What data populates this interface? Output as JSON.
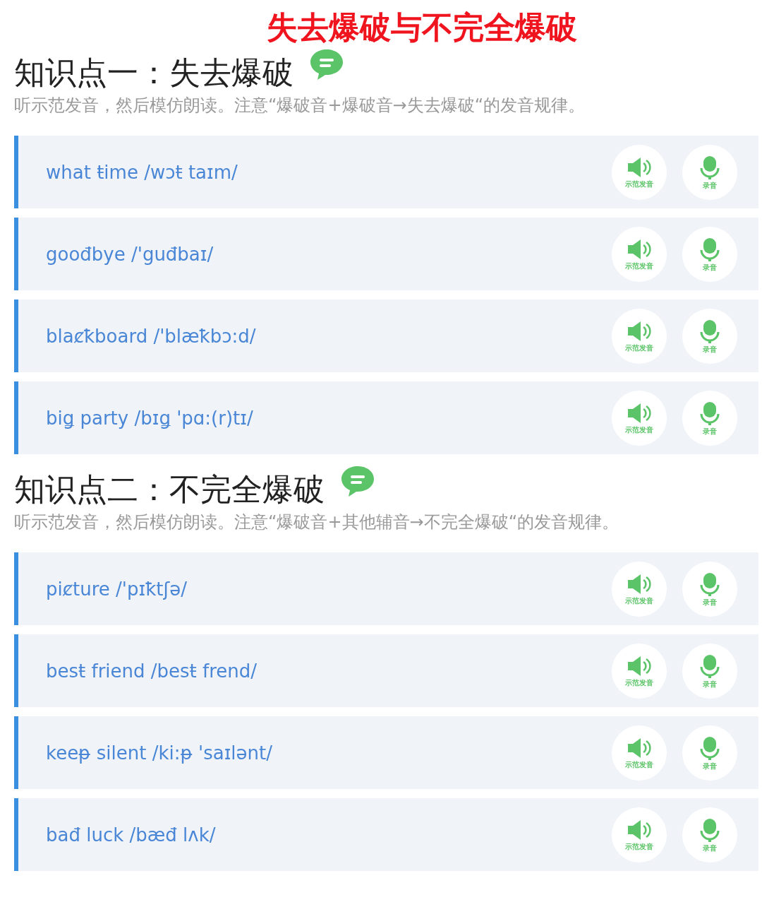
{
  "title": "失去爆破与不完全爆破",
  "sections": [
    {
      "heading": "知识点一：失去爆破",
      "instruction": "听示范发音，然后模仿朗读。注意“爆破音+爆破音→失去爆破“的发音规律。",
      "items": [
        {
          "text": "what ŧime /wɔŧ taɪm/",
          "play_label": "示范发音",
          "record_label": "录音"
        },
        {
          "text": "goođbye /'guđbaɪ/",
          "play_label": "示范发音",
          "record_label": "录音"
        },
        {
          "text": "blaȼꝁboard /'blæꝁbɔ:d/",
          "play_label": "示范发音",
          "record_label": "录音"
        },
        {
          "text": "biǥ party /bɪǥ 'pɑ:(r)tɪ/",
          "play_label": "示范发音",
          "record_label": "录音"
        }
      ]
    },
    {
      "heading": "知识点二：不完全爆破",
      "instruction": "听示范发音，然后模仿朗读。注意“爆破音+其他辅音→不完全爆破“的发音规律。",
      "items": [
        {
          "text": "piȼture /'pɪꝁtʃə/",
          "play_label": "示范发音",
          "record_label": "录音"
        },
        {
          "text": "besŧ friend /besŧ frend/",
          "play_label": "示范发音",
          "record_label": "录音"
        },
        {
          "text": "keeᵽ silent /ki:ᵽ 'saɪlənt/",
          "play_label": "示范发音",
          "record_label": "录音"
        },
        {
          "text": "bađ luck /bæđ lʌk/",
          "play_label": "示范发音",
          "record_label": "录音"
        }
      ]
    }
  ]
}
